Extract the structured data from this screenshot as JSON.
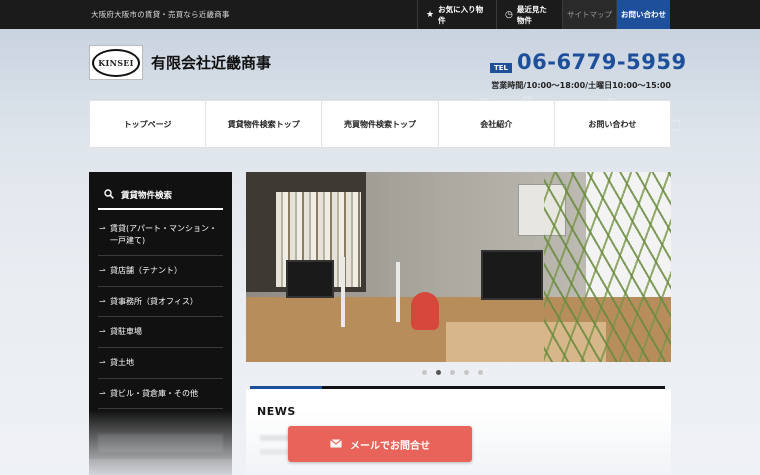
{
  "topbar": {
    "tagline": "大阪府大阪市の賃貸・売買なら近畿商事",
    "links": {
      "favorites": "お気に入り物件",
      "recent": "最近見た物件",
      "sitemap": "サイトマップ",
      "contact": "お問い合わせ"
    },
    "icons": {
      "favorites": "star-icon",
      "recent": "history-icon"
    }
  },
  "header": {
    "logo_text": "KINSEI",
    "company_name": "有限会社近畿商事",
    "tel_label": "TEL",
    "tel_number": "06-6779-5959",
    "hours": "営業時間/10:00～18:00/土曜日10:00～15:00"
  },
  "nav": {
    "items": [
      "トップページ",
      "賃貸物件検索トップ",
      "売買物件検索トップ",
      "会社紹介",
      "お問い合わせ"
    ]
  },
  "sidebar": {
    "title": "賃貸物件検索",
    "title_icon": "search-icon",
    "items": [
      "賃貸(アパート・マンション・一戸建て)",
      "貸店舗（テナント）",
      "貸事務所（貸オフィス）",
      "貸駐車場",
      "貸土地",
      "貸ビル・貸倉庫・その他"
    ]
  },
  "slider": {
    "slide_count": 5,
    "active_index": 1
  },
  "news": {
    "title": "NEWS"
  },
  "cta": {
    "mail_label": "メールでお問合せ",
    "mail_icon": "envelope-icon"
  },
  "colors": {
    "brand_blue": "#1d4f9a",
    "cta_red": "#e8645a",
    "topbar_bg": "#1b1b1b"
  }
}
